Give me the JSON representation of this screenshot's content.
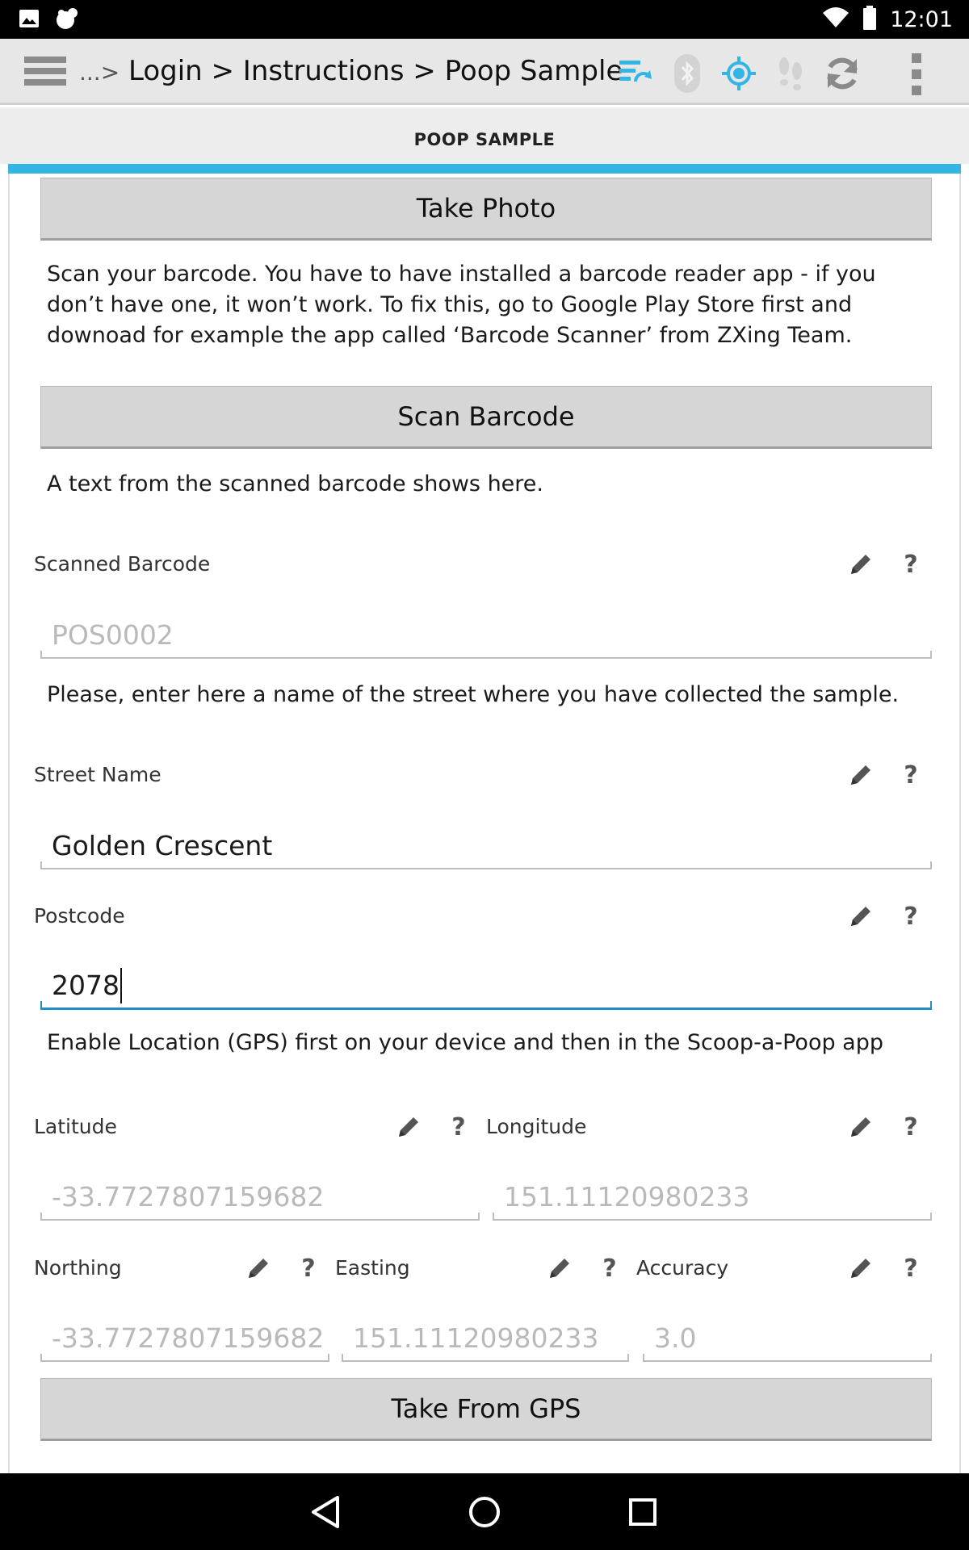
{
  "status_bar": {
    "time": "12:01"
  },
  "action_bar": {
    "breadcrumb_prefix": "...>",
    "breadcrumb": "Login > Instructions > Poop Sample"
  },
  "tab": {
    "label": "POOP SAMPLE"
  },
  "colors": {
    "accent": "#33b5e5",
    "focus": "#1f8fc9"
  },
  "form": {
    "take_photo_label": "Take Photo",
    "barcode_instructions": "Scan your barcode. You have to have installed a barcode reader app - if you don’t have one, it won’t work. To fix this, go to Google Play Store first and downoad for example the app called ‘Barcode Scanner’ from ZXing Team.",
    "scan_barcode_label": "Scan Barcode",
    "scanned_hint": "A text from the scanned barcode shows here.",
    "scanned_barcode": {
      "label": "Scanned Barcode",
      "placeholder": "POS0002"
    },
    "street_hint": "Please, enter here a name of the street where you have collected the sample.",
    "street_name": {
      "label": "Street Name",
      "value": "Golden Crescent"
    },
    "postcode": {
      "label": "Postcode",
      "value": "2078"
    },
    "gps_hint": "Enable Location (GPS) first on your device and then in the Scoop-a-Poop app",
    "latitude": {
      "label": "Latitude",
      "placeholder": "-33.7727807159682"
    },
    "longitude": {
      "label": "Longitude",
      "placeholder": "151.11120980233"
    },
    "northing": {
      "label": "Northing",
      "placeholder": "-33.7727807159682"
    },
    "easting": {
      "label": "Easting",
      "placeholder": "151.11120980233"
    },
    "accuracy": {
      "label": "Accuracy",
      "placeholder": "3.0"
    },
    "take_from_gps_label": "Take From GPS",
    "help_glyph": "?"
  }
}
